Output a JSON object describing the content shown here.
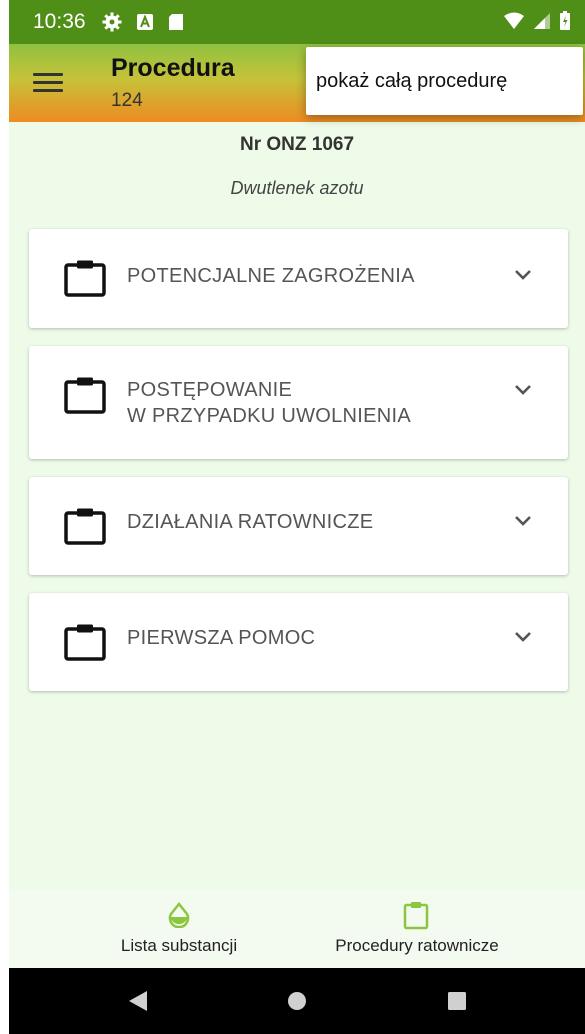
{
  "status_bar": {
    "time": "10:36",
    "icons": [
      "gear-icon",
      "a-icon",
      "sd-card-icon",
      "wifi-icon",
      "signal-icon",
      "battery-icon"
    ]
  },
  "app_bar": {
    "title": "Procedura",
    "subtitle": "124",
    "menu_item": "pokaż całą procedurę"
  },
  "header": {
    "onz_number": "Nr ONZ 1067",
    "substance_name": "Dwutlenek azotu"
  },
  "sections": [
    {
      "label": "POTENCJALNE ZAGROŻENIA"
    },
    {
      "label_line1": "POSTĘPOWANIE",
      "label_line2": "W PRZYPADKU UWOLNIENIA"
    },
    {
      "label": "DZIAŁANIA RATOWNICZE"
    },
    {
      "label": "PIERWSZA POMOC"
    }
  ],
  "bottom_nav": [
    {
      "label": "Lista substancji",
      "icon": "drop-icon"
    },
    {
      "label": "Procedury ratownicze",
      "icon": "clipboard-icon"
    }
  ],
  "colors": {
    "status_bar": "#4f8f18",
    "background": "#eefbe9",
    "accent_green": "#8fc13f",
    "accent_orange": "#ee8b22"
  }
}
